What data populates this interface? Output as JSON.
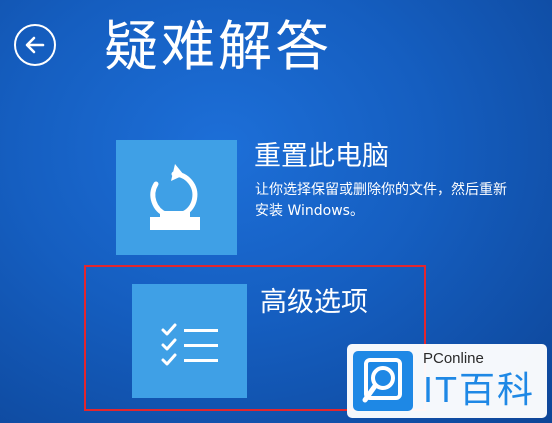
{
  "screen": {
    "title": "疑难解答",
    "back_icon": "back-arrow-icon"
  },
  "options": [
    {
      "title": "重置此电脑",
      "description": "让你选择保留或删除你的文件，然后重新安装 Windows。",
      "icon": "reset-pc-icon"
    },
    {
      "title": "高级选项",
      "icon": "checklist-icon",
      "highlighted": true
    }
  ],
  "watermark": {
    "brand": "PConline",
    "name": "IT百科",
    "icon": "search-logo-icon"
  },
  "colors": {
    "background": "#155ec0",
    "tile": "#3fa0e6",
    "highlight": "#e3262d",
    "watermark_accent": "#1e88e5"
  }
}
